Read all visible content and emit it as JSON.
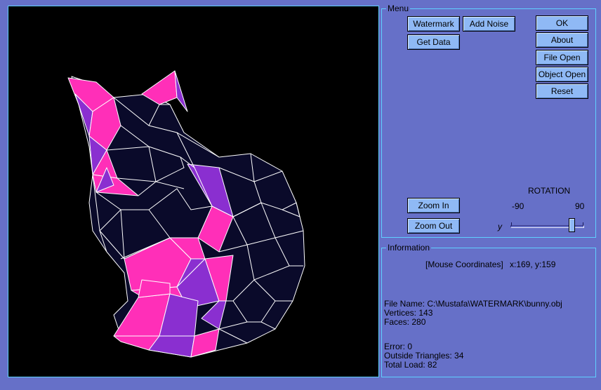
{
  "menu": {
    "legend": "Menu",
    "buttons": {
      "watermark": "Watermark",
      "add_noise": "Add Noise",
      "get_data": "Get Data",
      "ok": "OK",
      "about": "About",
      "file_open": "File Open",
      "object_open": "Object Open",
      "reset": "Reset",
      "zoom_in": "Zoom In",
      "zoom_out": "Zoom Out"
    },
    "rotation": {
      "title": "ROTATION",
      "min_label": "-90",
      "max_label": "90",
      "axis_label": "y",
      "min": -90,
      "max": 90,
      "value": 60
    }
  },
  "info": {
    "legend": "Information",
    "mouse_coords_label": "[Mouse Coordinates]",
    "mouse_coords_value": "x:169, y:159",
    "file_name": "File Name: C:\\Mustafa\\WATERMARK\\bunny.obj",
    "vertices": "Vertices: 143",
    "faces": "Faces: 280",
    "error": "Error: 0",
    "outside_triangles": "Outside Triangles: 34",
    "total_load": "Total Load: 82"
  },
  "colors": {
    "background": "#6670c8",
    "viewport": "#000000",
    "mesh_dark": "#0a0a2a",
    "mesh_pink": "#ff2fb8",
    "mesh_purple": "#8a2fd0",
    "mesh_edge": "#ffffff",
    "button": "#8fb9f5",
    "frame": "#5fd0ff"
  }
}
